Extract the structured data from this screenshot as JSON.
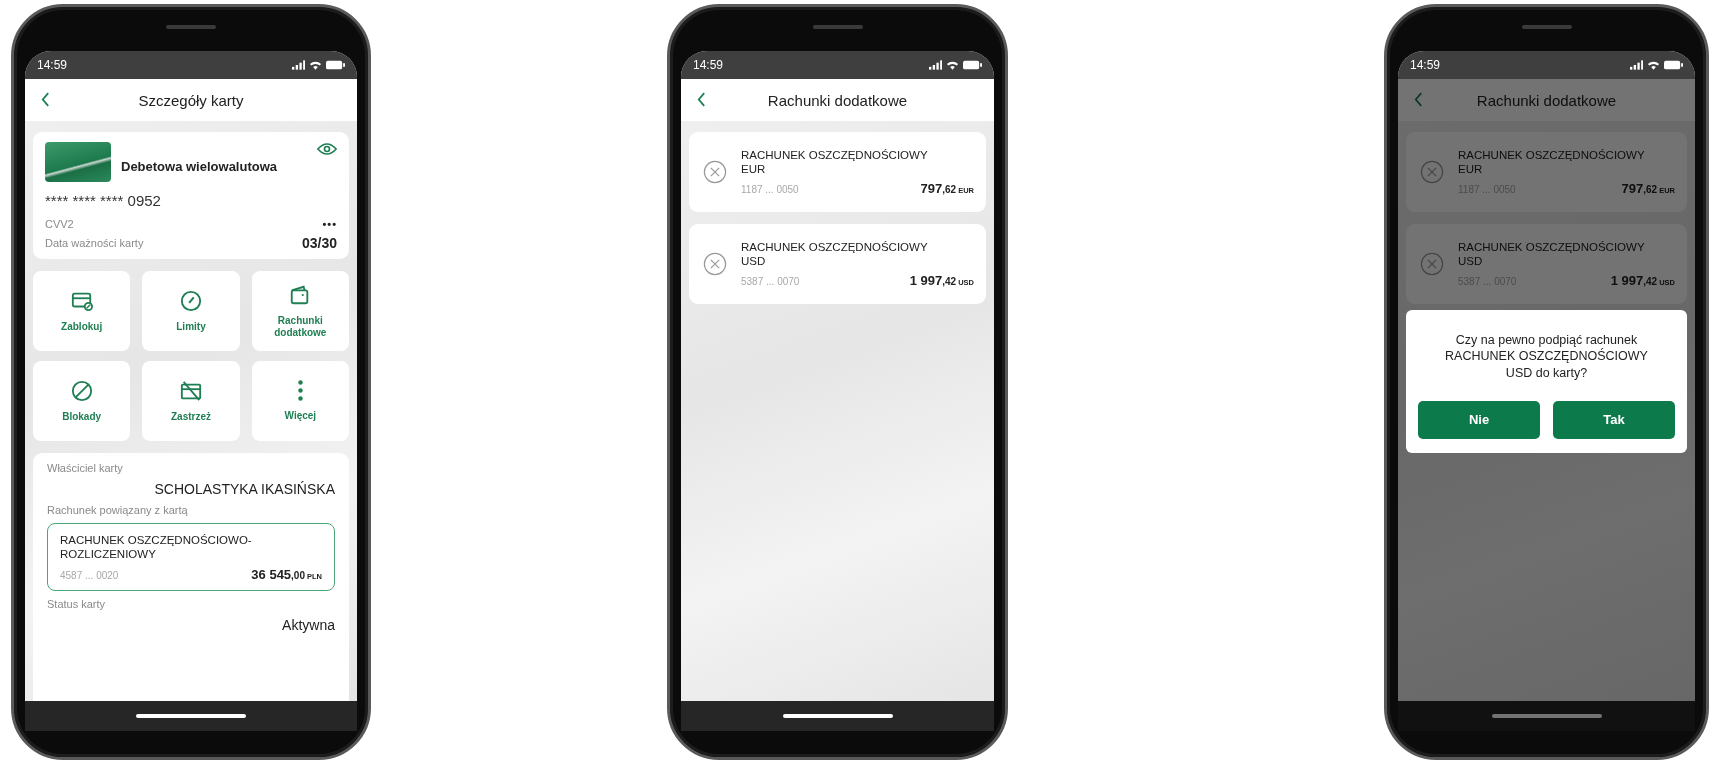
{
  "screens": [
    {
      "kind": "card_details",
      "time": "14:59",
      "title": "Szczegóły karty",
      "card": {
        "name": "Debetowa wielowalutowa",
        "number": "**** **** **** 0952",
        "cvv_label": "CVV2",
        "cvv_value": "•••",
        "expiry_label": "Data ważności karty",
        "expiry_value": "03/30"
      },
      "actions": [
        {
          "label": "Zablokuj"
        },
        {
          "label": "Limity"
        },
        {
          "label": "Rachunki dodatkowe"
        },
        {
          "label": "Blokady"
        },
        {
          "label": "Zastrzeż"
        },
        {
          "label": "Więcej"
        }
      ],
      "owner_label": "Właściciel karty",
      "owner": "SCHOLASTYKA IKASIŃSKA",
      "linked_label": "Rachunek powiązany z kartą",
      "linked_account": {
        "name": "RACHUNEK OSZCZĘDNOŚCIOWO-ROZLICZENIOWY",
        "number": "4587 ... 0020",
        "whole": "36 545",
        "fraction": ",00",
        "currency": "PLN"
      },
      "status_label": "Status karty",
      "status": "Aktywna"
    },
    {
      "kind": "accounts",
      "time": "14:59",
      "title": "Rachunki dodatkowe",
      "accounts": [
        {
          "name": "RACHUNEK OSZCZĘDNOŚCIOWY EUR",
          "number": "1187 ... 0050",
          "whole": "797",
          "fraction": ",62",
          "currency": "EUR"
        },
        {
          "name": "RACHUNEK OSZCZĘDNOŚCIOWY USD",
          "number": "5387 ... 0070",
          "whole": "1 997",
          "fraction": ",42",
          "currency": "USD"
        }
      ]
    },
    {
      "kind": "accounts",
      "time": "14:59",
      "title": "Rachunki dodatkowe",
      "accounts": [
        {
          "name": "RACHUNEK OSZCZĘDNOŚCIOWY EUR",
          "number": "1187 ... 0050",
          "whole": "797",
          "fraction": ",62",
          "currency": "EUR"
        },
        {
          "name": "RACHUNEK OSZCZĘDNOŚCIOWY USD",
          "number": "5387 ... 0070",
          "whole": "1 997",
          "fraction": ",42",
          "currency": "USD"
        }
      ],
      "dialog": {
        "message": "Czy na pewno podpiąć rachunek RACHUNEK OSZCZĘDNOŚCIOWY USD do karty?",
        "buttons": [
          "Nie",
          "Tak"
        ]
      }
    }
  ]
}
